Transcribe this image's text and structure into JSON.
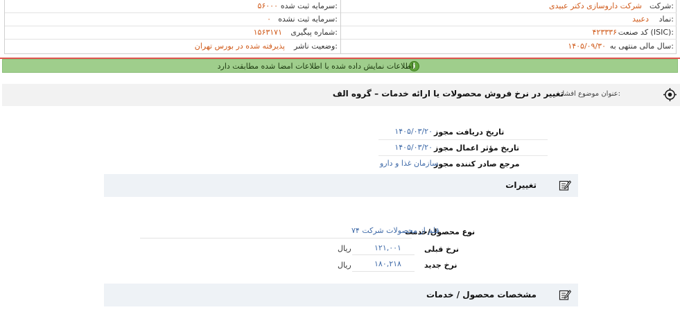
{
  "company_info": {
    "company_label": "شرکت:",
    "company_value": "شرکت داروسازی دکتر عبیدی",
    "symbol_label": "نماد:",
    "symbol_value": "دعبید",
    "isic_label": "کد صنعت (ISIC):",
    "isic_value": "۴۲۳۳۳۶",
    "fiscal_year_label": "سال مالی منتهی به:",
    "fiscal_year_value": "۱۴۰۵/۰۹/۳۰",
    "registered_capital_label": "سرمایه ثبت شده:",
    "registered_capital_value": "۵۶۰۰۰",
    "unregistered_capital_label": "سرمایه ثبت نشده:",
    "unregistered_capital_value": "۰",
    "tracking_number_label": "شماره پیگیری:",
    "tracking_number_value": "۱۵۶۳۱۷۱",
    "publisher_status_label": "وضعیت ناشر:",
    "publisher_status_value": "پذیرفته شده در بورس تهران"
  },
  "alert": {
    "text": "اطلاعات نمایش داده شده با اطلاعات امضا شده مطابقت دارد."
  },
  "subject": {
    "label": "عنوان موضوع افشا:",
    "title": "تغییر در نرخ فروش محصولات یا ارائه خدمات – گروه الف"
  },
  "permit": {
    "receive_date_label": "تاریخ دریافت مجوز",
    "receive_date_value": "۱۴۰۵/۰۳/۲۰",
    "effective_date_label": "تاریخ مؤثر اعمال مجوز",
    "effective_date_value": "۱۴۰۵/۰۳/۲۰",
    "issuer_label": "مرجع صادر کننده مجوز",
    "issuer_value": "سازمان غذا و دارو"
  },
  "changes": {
    "section_title": "تغییرات",
    "product_type_label": "نوع محصول/خدمت",
    "product_type_value": "۷۴ قلم از محصولات شرکت",
    "previous_rate_label": "نرخ قبلی",
    "previous_rate_value": "۱۲۱,۰۰۱",
    "previous_rate_unit": "ریال",
    "new_rate_label": "نرخ جدید",
    "new_rate_value": "۱۸۰,۲۱۸",
    "new_rate_unit": "ریال"
  },
  "product_specs": {
    "section_title": "مشخصات محصول / خدمات"
  },
  "colors": {
    "value_orange": "#d05a1a",
    "value_blue": "#3f6aa8",
    "alert_green": "#9fce8c",
    "alert_border_red": "#e0554f"
  },
  "icons": {
    "alert": "info-icon",
    "subject": "target-icon",
    "sections": "edit-icon"
  }
}
